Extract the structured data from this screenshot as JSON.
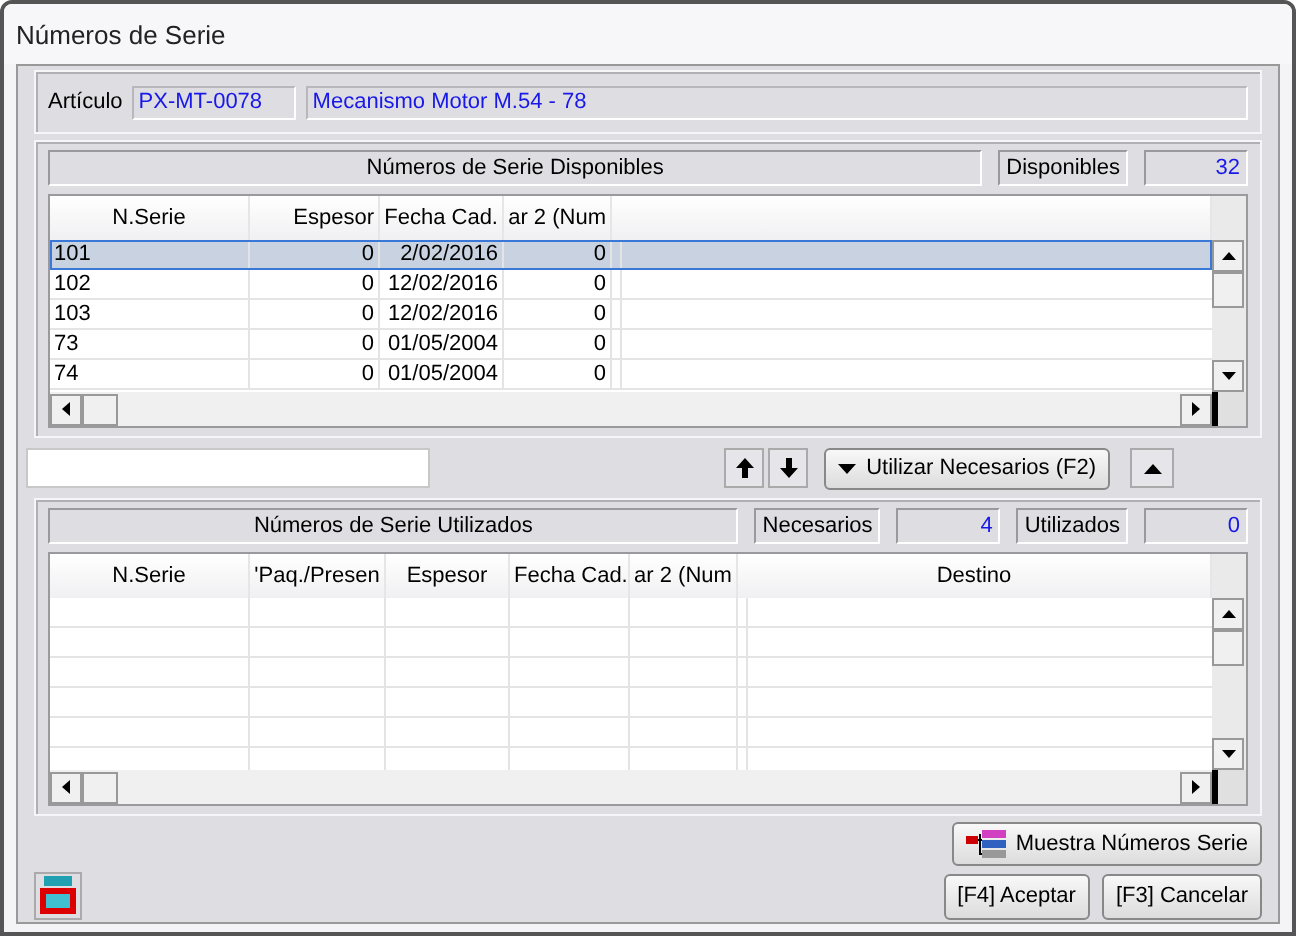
{
  "window": {
    "title": "Números de Serie"
  },
  "article": {
    "label": "Artículo",
    "code": "PX-MT-0078",
    "description": "Mecanismo Motor M.54 - 78"
  },
  "available": {
    "title": "Números de Serie Disponibles",
    "count_label": "Disponibles",
    "count": "32",
    "columns": [
      "N.Serie",
      "Espesor",
      "Fecha Cad.",
      "ar 2 (Num"
    ],
    "rows": [
      {
        "cells": [
          "101",
          "0",
          "2/02/2016",
          "0"
        ],
        "selected": true
      },
      {
        "cells": [
          "102",
          "0",
          "12/02/2016",
          "0"
        ],
        "selected": false
      },
      {
        "cells": [
          "103",
          "0",
          "12/02/2016",
          "0"
        ],
        "selected": false
      },
      {
        "cells": [
          "73",
          "0",
          "01/05/2004",
          "0"
        ],
        "selected": false
      },
      {
        "cells": [
          "74",
          "0",
          "01/05/2004",
          "0"
        ],
        "selected": false
      }
    ]
  },
  "toolbar": {
    "use_button": "Utilizar Necesarios (F2)"
  },
  "used": {
    "title": "Números de Serie Utilizados",
    "needed_label": "Necesarios",
    "needed": "4",
    "used_label": "Utilizados",
    "used": "0",
    "columns": [
      "N.Serie",
      "'Paq./Presen",
      "Espesor",
      "Fecha Cad.",
      "ar 2 (Num",
      "Destino"
    ]
  },
  "buttons": {
    "show": "Muestra Números Serie",
    "accept": "[F4] Aceptar",
    "cancel": "[F3] Cancelar"
  }
}
